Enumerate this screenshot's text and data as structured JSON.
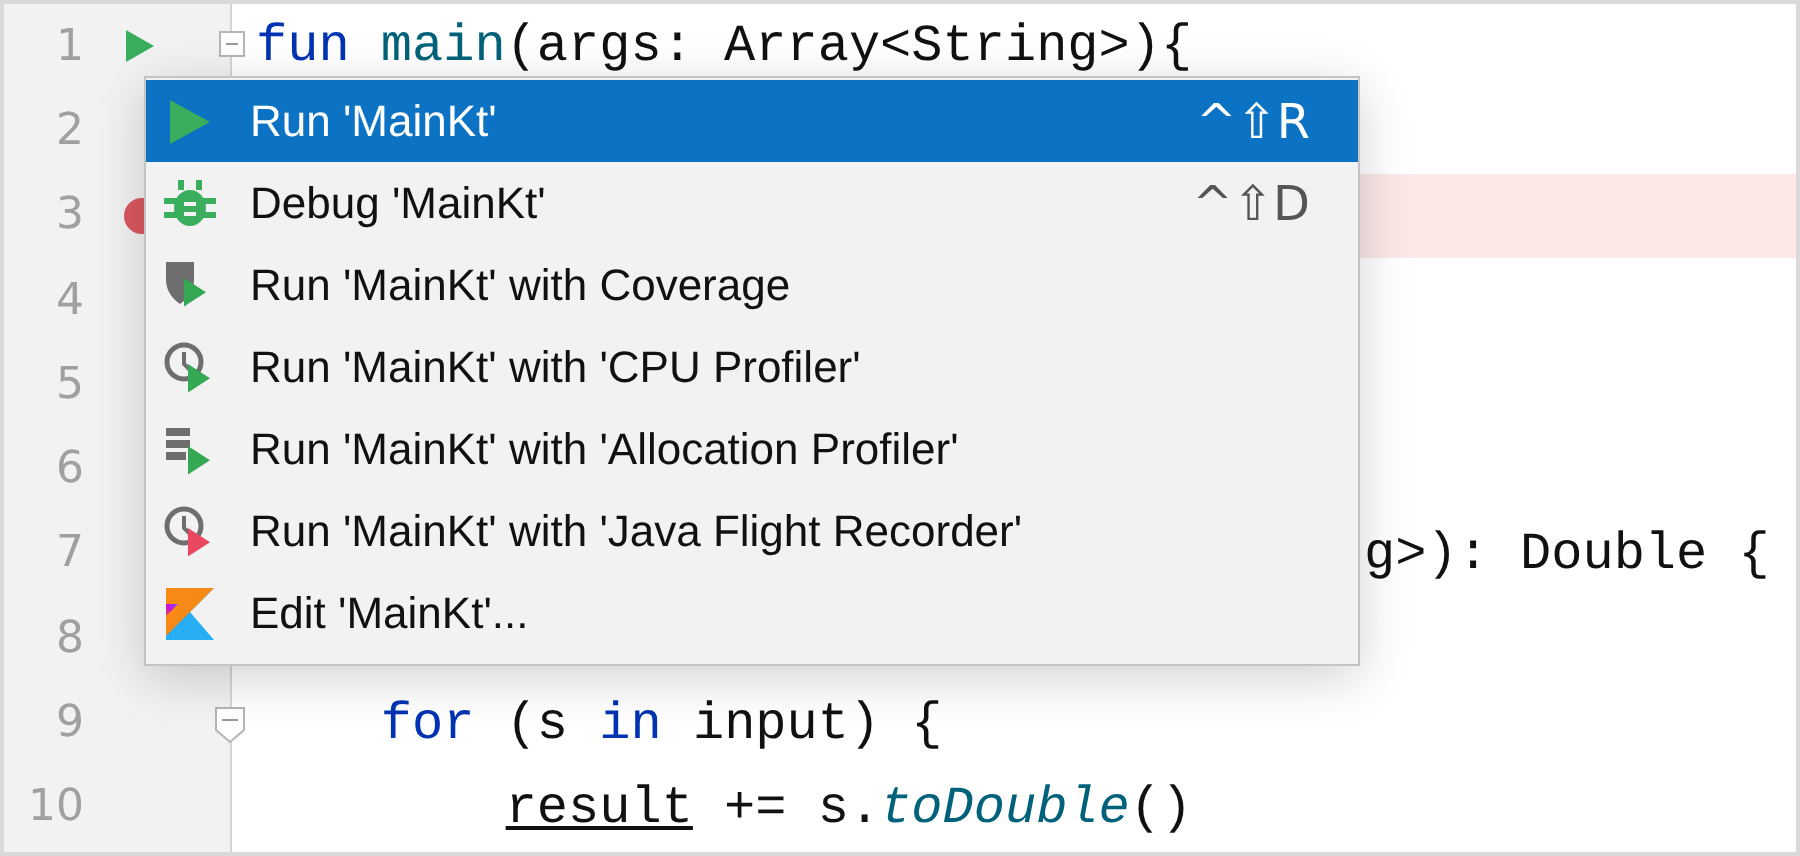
{
  "lines": [
    {
      "number": "1",
      "kind": "run",
      "fold_start": true,
      "fold_end": false,
      "highlighted": false,
      "tokens": [
        {
          "text": "fun",
          "kind": "keyword"
        },
        {
          "text": " main",
          "kind": "function"
        },
        {
          "text": "(args: Array<String>){",
          "kind": "plain"
        }
      ]
    },
    {
      "number": "2",
      "kind": "plain",
      "highlighted": false
    },
    {
      "number": "3",
      "kind": "breakpoint",
      "highlighted": true
    },
    {
      "number": "4",
      "kind": "plain",
      "highlighted": false
    },
    {
      "number": "5",
      "kind": "plain",
      "highlighted": false
    },
    {
      "number": "6",
      "kind": "plain",
      "highlighted": false
    },
    {
      "number": "7",
      "kind": "plain",
      "highlighted": false,
      "behind_menu": true,
      "tokens": [
        {
          "text": "g>): Double {",
          "kind": "plain"
        }
      ]
    },
    {
      "number": "8",
      "kind": "plain",
      "highlighted": false
    },
    {
      "number": "9",
      "kind": "plain",
      "fold_start": false,
      "fold_end": true,
      "highlighted": false,
      "tokens": [
        {
          "text": "    for",
          "kind": "keyword"
        },
        {
          "text": " (s ",
          "kind": "plain"
        },
        {
          "text": "in",
          "kind": "keyword"
        },
        {
          "text": " input) {",
          "kind": "plain"
        }
      ]
    },
    {
      "number": "10",
      "kind": "plain",
      "fold_start": false,
      "fold_end": false,
      "highlighted": false,
      "tokens": [
        {
          "text": "        result",
          "kind": "underlined"
        },
        {
          "text": " += s.",
          "kind": "plain"
        },
        {
          "text": "toDouble",
          "kind": "call"
        },
        {
          "text": "()",
          "kind": "plain"
        }
      ]
    }
  ],
  "menu": {
    "items": [
      {
        "kind": "run",
        "label": "Run 'MainKt'",
        "shortcut": "^⇧R",
        "selected": true
      },
      {
        "kind": "debug",
        "label": "Debug 'MainKt'",
        "shortcut": "^⇧D",
        "selected": false
      },
      {
        "kind": "coverage",
        "label": "Run 'MainKt' with Coverage",
        "selected": false
      },
      {
        "kind": "cpu",
        "label": "Run 'MainKt' with 'CPU Profiler'",
        "selected": false
      },
      {
        "kind": "allocation",
        "label": "Run 'MainKt' with 'Allocation Profiler'",
        "selected": false
      },
      {
        "kind": "recorder",
        "label": "Run 'MainKt' with 'Java Flight Recorder'",
        "selected": false
      },
      {
        "kind": "edit",
        "label": "Edit 'MainKt'...",
        "selected": false
      }
    ]
  }
}
